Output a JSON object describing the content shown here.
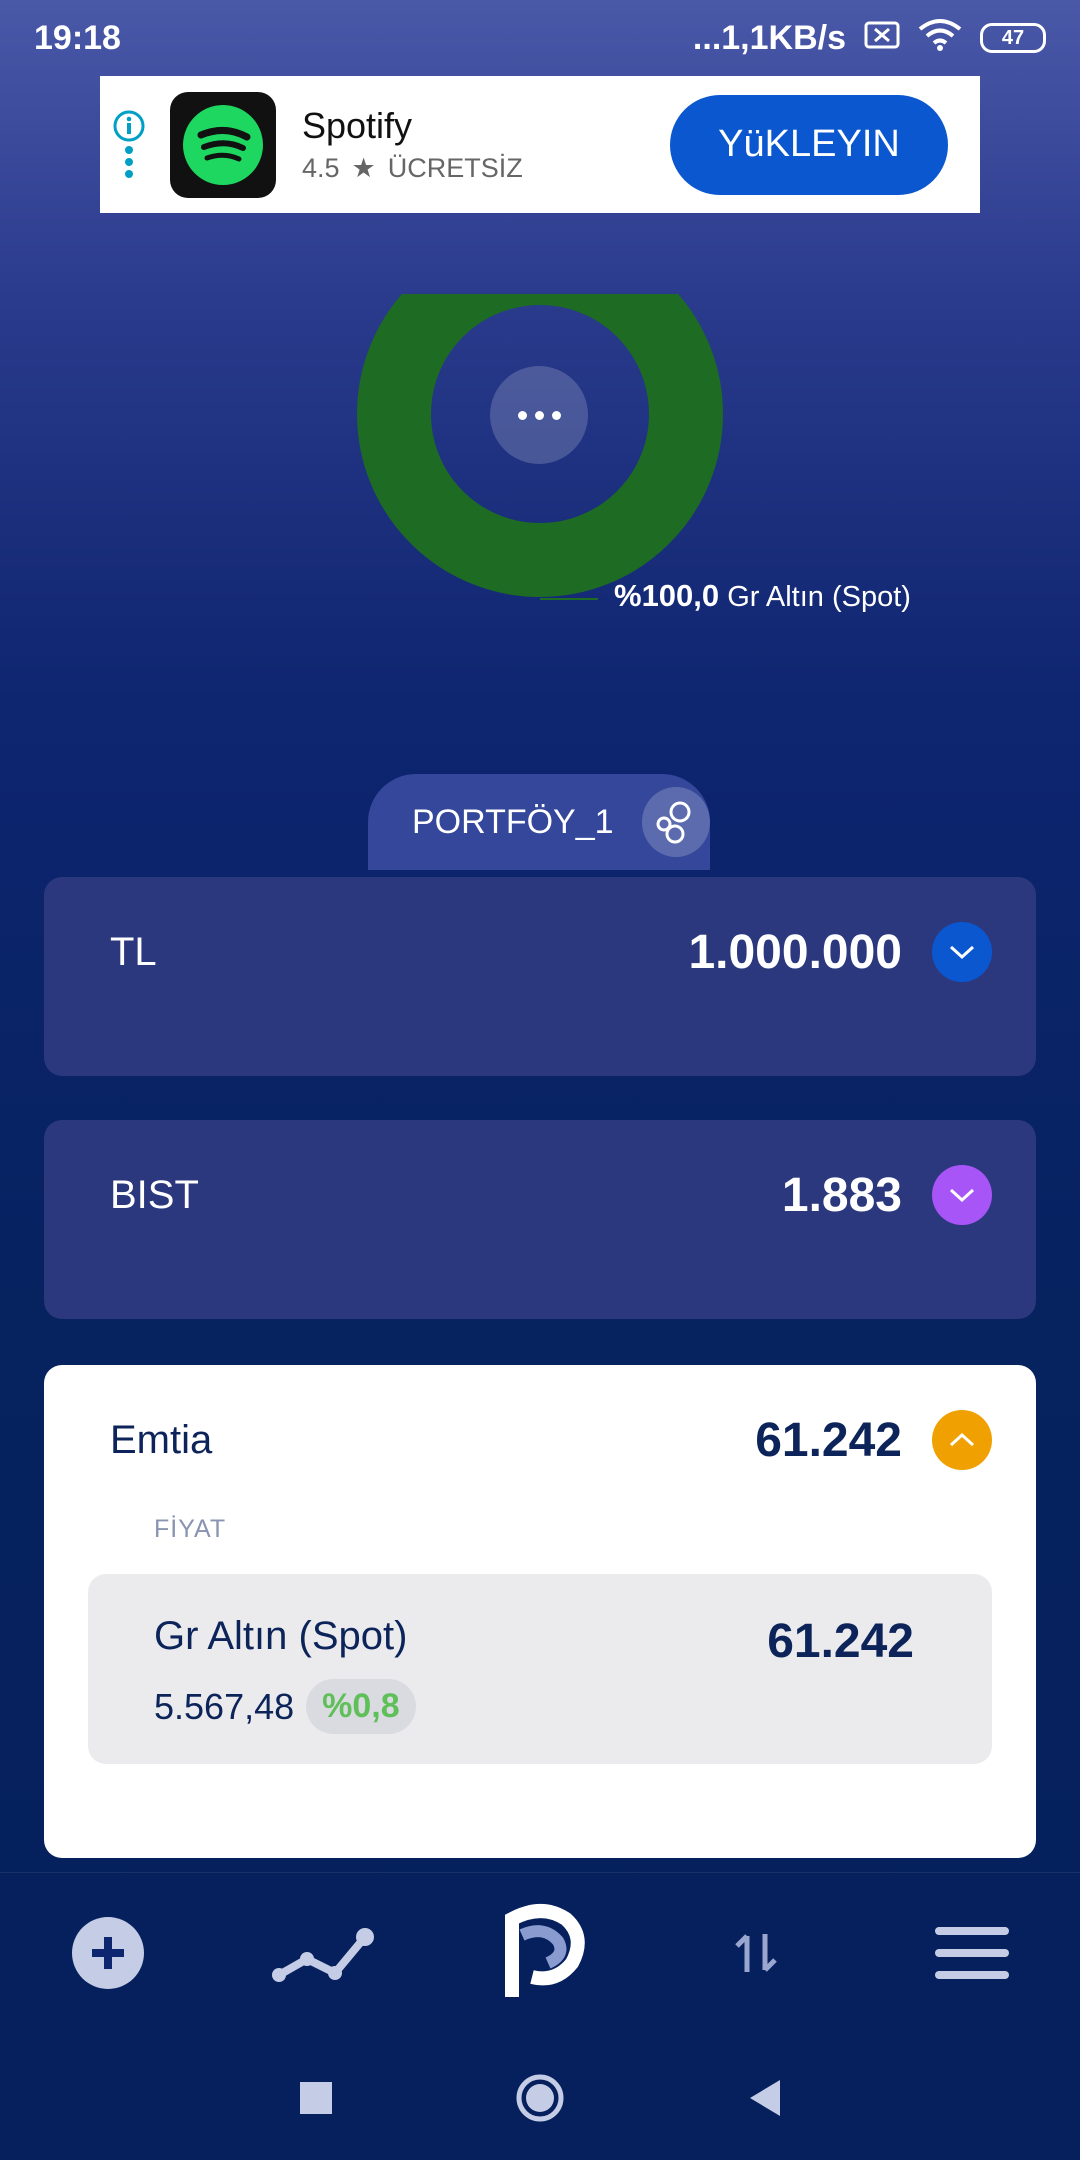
{
  "status_bar": {
    "time": "19:18",
    "network_speed": "...1,1KB/s",
    "battery": "47"
  },
  "ad": {
    "app_name": "Spotify",
    "rating": "4.5",
    "price": "ÜCRETSİZ",
    "install_label": "YüKLEYIN"
  },
  "chart_data": {
    "type": "pie",
    "series": [
      {
        "name": "Gr Altın (Spot)",
        "values": [
          100.0
        ],
        "color": "#1e6b24"
      }
    ],
    "labels": [
      {
        "percent": "%100,0",
        "name": "Gr Altın (Spot)"
      }
    ]
  },
  "portfolio": {
    "name": "PORTFÖY_1"
  },
  "cards": {
    "tl": {
      "title": "TL",
      "value": "1.000.000",
      "accent": "#0b57d0"
    },
    "bist": {
      "title": "BIST",
      "value": "1.883",
      "accent": "#a855f7"
    },
    "emtia": {
      "title": "Emtia",
      "value": "61.242",
      "accent": "#f0a000",
      "column_header": "FİYAT",
      "items": [
        {
          "name": "Gr Altın (Spot)",
          "price": "5.567,48",
          "change": "%0,8",
          "value": "61.242"
        }
      ]
    }
  },
  "bottom_nav": {
    "icons": [
      "add-icon",
      "chart-line-icon",
      "app-logo-icon",
      "transfer-icon",
      "menu-icon"
    ]
  },
  "system_nav": {
    "icons": [
      "recent-apps-icon",
      "home-icon",
      "back-icon"
    ]
  }
}
